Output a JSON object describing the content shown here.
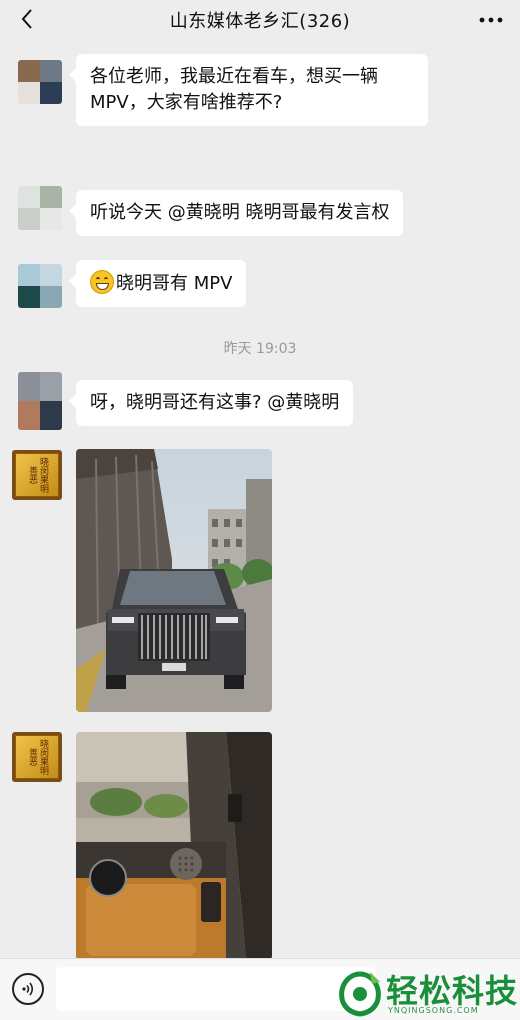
{
  "header": {
    "title": "山东媒体老乡汇(326)"
  },
  "messages": [
    {
      "lines": [
        "各位老师，我最近在看车，想买一辆",
        "MPV，大家有啥推荐不?"
      ]
    },
    {
      "text": "听说今天 @黄晓明 晓明哥最有发言权"
    },
    {
      "text": "晓明哥有 MPV",
      "emoji": "grinning-emoji"
    },
    {
      "text": "呀，晓明哥还有这事? @黄晓明"
    }
  ],
  "timestamp": "昨天 19:03",
  "photos": [
    {
      "subject": "black luxury MPV front view on street"
    },
    {
      "subject": "car interior door panel with speaker"
    }
  ],
  "avatar_badge": {
    "text": "晓闵果明善恶"
  },
  "watermark": {
    "text": "轻松科技",
    "sub": "YNQINGSONG.COM"
  },
  "colors": {
    "background": "#ededed",
    "bubble": "#ffffff",
    "watermark_green": "#1a8f3a"
  },
  "icons": {
    "back": "chevron-left-icon",
    "more": "more-dots-icon",
    "voice": "voice-icon"
  }
}
